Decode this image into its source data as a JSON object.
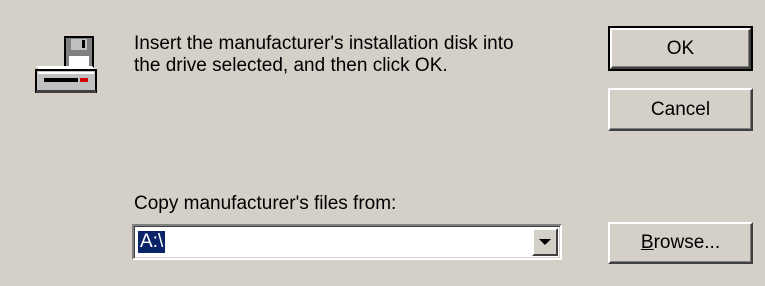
{
  "icon": "floppy-drive-icon",
  "message": {
    "line1": "Insert the manufacturer's installation disk into",
    "line2": "the drive selected, and then click OK."
  },
  "buttons": {
    "ok_label": "OK",
    "cancel_label": "Cancel",
    "browse_mnemonic": "B",
    "browse_rest": "rowse..."
  },
  "copy_from": {
    "label": "Copy manufacturer's files from:",
    "value": "A:\\",
    "dropdown_icon": "chevron-down-icon"
  },
  "colors": {
    "dialog_bg": "#d4d0c8",
    "selection_bg": "#0a246a",
    "selection_fg": "#ffffff"
  }
}
